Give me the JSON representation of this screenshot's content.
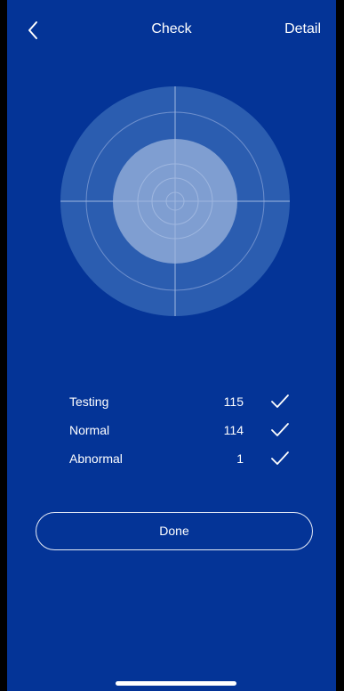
{
  "nav": {
    "title": "Check",
    "detail_label": "Detail",
    "back_icon": "chevron-left-icon"
  },
  "radar": {
    "outer_color": "#2b5db0",
    "inner_color": "#7f9ed1",
    "line_color": "#7d9ed6"
  },
  "stats": [
    {
      "label": "Testing",
      "value": "115",
      "icon": "checkmark-icon"
    },
    {
      "label": "Normal",
      "value": "114",
      "icon": "checkmark-icon"
    },
    {
      "label": "Abnormal",
      "value": "1",
      "icon": "checkmark-icon"
    }
  ],
  "done_label": "Done",
  "colors": {
    "background": "#043497",
    "text": "#ffffff"
  }
}
